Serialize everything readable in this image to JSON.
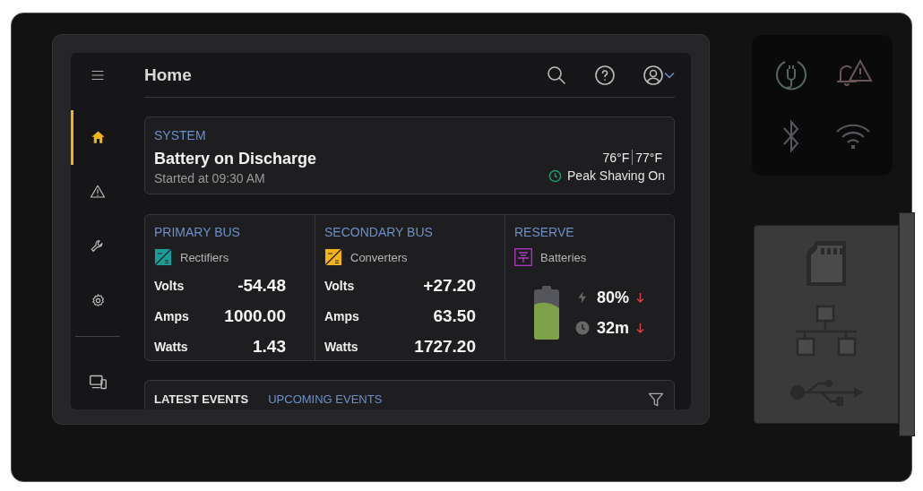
{
  "header": {
    "title": "Home"
  },
  "sidebar": {
    "items": [
      {
        "selected": true
      },
      {
        "selected": false
      },
      {
        "selected": false
      },
      {
        "selected": false
      },
      {
        "selected": false
      }
    ]
  },
  "system": {
    "label": "SYSTEM",
    "title": "Battery on Discharge",
    "subtitle": "Started at 09:30 AM",
    "temperatures": [
      "76°F",
      "77°F"
    ],
    "mode": "Peak Shaving On"
  },
  "buses": [
    {
      "title": "PRIMARY BUS",
      "source": "Rectifiers",
      "color": "#1a9c98",
      "readings": [
        {
          "label": "Volts",
          "value": "-54.48"
        },
        {
          "label": "Amps",
          "value": "1000.00"
        },
        {
          "label": "Watts",
          "value": "1.43"
        }
      ]
    },
    {
      "title": "SECONDARY BUS",
      "source": "Converters",
      "color": "#f2b417",
      "readings": [
        {
          "label": "Volts",
          "value": "+27.20"
        },
        {
          "label": "Amps",
          "value": "63.50"
        },
        {
          "label": "Watts",
          "value": "1727.20"
        }
      ]
    }
  ],
  "reserve": {
    "title": "RESERVE",
    "source": "Batteries",
    "level": 0.75,
    "charge": "80%",
    "time": "32m"
  },
  "events": {
    "tabs": [
      {
        "label": "LATEST EVENTS",
        "selected": true
      },
      {
        "label": "UPCOMING EVENTS",
        "selected": false
      }
    ]
  }
}
